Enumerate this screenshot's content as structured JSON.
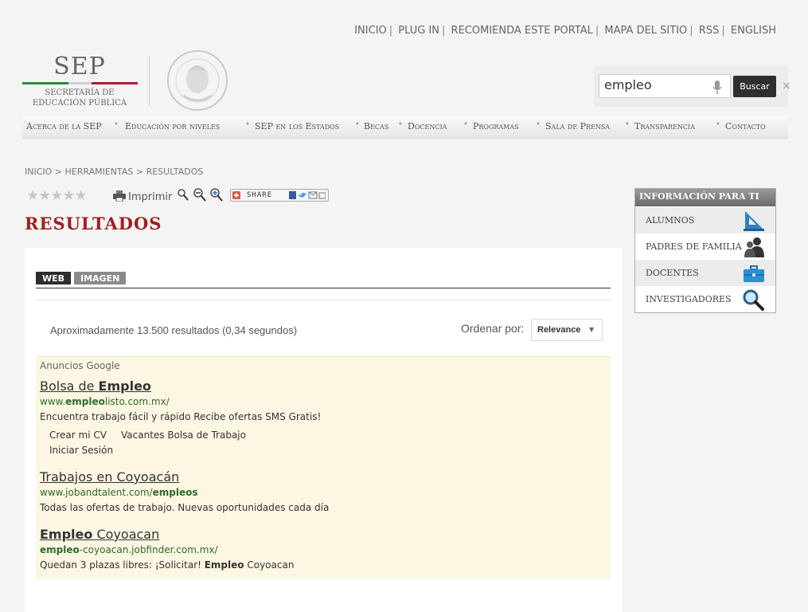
{
  "top_links": [
    "INICIO",
    "PLUG IN",
    "RECOMIENDA ESTE PORTAL",
    "MAPA DEL SITIO",
    "RSS",
    "ENGLISH"
  ],
  "top_links_separator": "|",
  "logo": {
    "abbr": "SEP",
    "line1": "SECRETARÍA DE",
    "line2": "EDUCACIÓN PÚBLICA"
  },
  "search": {
    "value": "empleo",
    "button": "Buscar",
    "clear": "×"
  },
  "nav": [
    "Acerca de la SEP",
    "Educación por niveles",
    "SEP en los Estados",
    "Becas",
    "Docencia",
    "Programas",
    "Sala de Prensa",
    "Transparencia",
    "Contacto"
  ],
  "nav_separator": "•",
  "breadcrumb": "INICIO > HERRAMIENTAS > RESULTADOS",
  "rating_stars": "★★★★★",
  "print_label": "Imprimir",
  "share_label": "SHARE",
  "page_title": "RESULTADOS",
  "tabs": {
    "web": "WEB",
    "image": "IMAGEN"
  },
  "results_count": "Aproximadamente 13.500 resultados (0,34 segundos)",
  "order": {
    "label": "Ordenar por:",
    "value": "Relevance"
  },
  "ads": {
    "label": "Anuncios Google",
    "items": [
      {
        "title_pre": "Bolsa de ",
        "title_bold": "Empleo",
        "title_post": "",
        "url_pre": "www.",
        "url_bold": "empleo",
        "url_post": "listo.com.mx/",
        "desc_pre": "Encuentra trabajo fácil y rápido Recibe ofertas SMS Gratis!",
        "desc_bold": "",
        "desc_post": "",
        "sublinks": [
          "Crear mi CV",
          "Vacantes Bolsa de Trabajo",
          "Iniciar Sesión"
        ]
      },
      {
        "title_pre": "Trabajos en Coyoacán",
        "title_bold": "",
        "title_post": "",
        "url_pre": "www.jobandtalent.com/",
        "url_bold": "empleos",
        "url_post": "",
        "desc_pre": "Todas las ofertas de trabajo. Nuevas oportunidades cada día",
        "desc_bold": "",
        "desc_post": ""
      },
      {
        "title_pre": "",
        "title_bold": "Empleo",
        "title_post": " Coyoacan",
        "url_pre": "",
        "url_bold": "empleo",
        "url_post": "-coyoacan.jobfinder.com.mx/",
        "desc_pre": "Quedan 3 plazas libres: ¡Solicitar! ",
        "desc_bold": "Empleo",
        "desc_post": " Coyoacan"
      }
    ]
  },
  "sidebar": {
    "title": "INFORMACIÓN PARA TI",
    "items": [
      {
        "label": "ALUMNOS",
        "icon": "ruler-triangle-icon"
      },
      {
        "label": "PADRES DE FAMILIA",
        "icon": "parents-icon"
      },
      {
        "label": "DOCENTES",
        "icon": "briefcase-icon"
      },
      {
        "label": "INVESTIGADORES",
        "icon": "magnifier-icon"
      }
    ]
  },
  "colors": {
    "title_red": "#a02022",
    "ad_bg": "#fdf6e3",
    "url_green": "#2e6b2a"
  }
}
